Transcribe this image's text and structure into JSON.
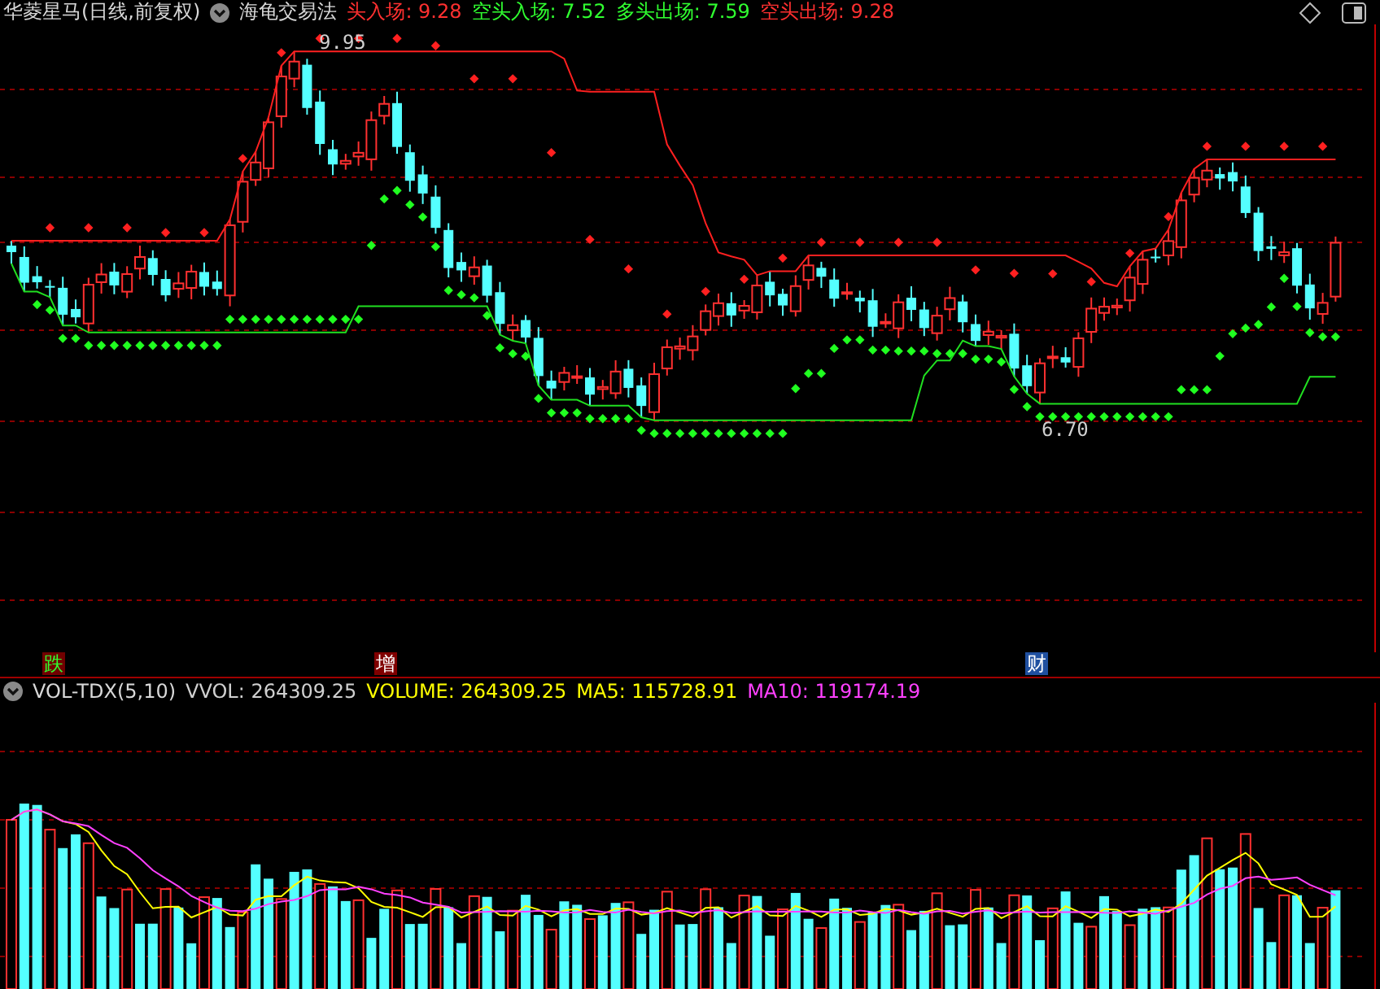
{
  "header": {
    "title": "华菱星马(日线,前复权)",
    "indicator": "海龟交易法",
    "readings": [
      {
        "text": "头入场: 9.28",
        "color": "#ff3030"
      },
      {
        "text": "空头入场: 7.52",
        "color": "#30ff30"
      },
      {
        "text": "多头出场: 7.59",
        "color": "#30ff30"
      },
      {
        "text": "空头出场: 9.28",
        "color": "#ff3030"
      }
    ]
  },
  "price_labels": [
    {
      "text": "9.95",
      "kind": "high"
    },
    {
      "text": "6.70",
      "kind": "low"
    }
  ],
  "markers": [
    {
      "text": "跌",
      "kind": "down"
    },
    {
      "text": "增",
      "kind": "up"
    },
    {
      "text": "财",
      "kind": "info"
    }
  ],
  "volume": {
    "indicator": "VOL-TDX(5,10)",
    "readings": [
      {
        "text": "VVOL: 264309.25",
        "color": "#d0d0d0"
      },
      {
        "text": "VOLUME: 264309.25",
        "color": "#ffff00"
      },
      {
        "text": "MA5: 115728.91",
        "color": "#ffff00"
      },
      {
        "text": "MA10: 119174.19",
        "color": "#ff40ff"
      }
    ]
  }
}
